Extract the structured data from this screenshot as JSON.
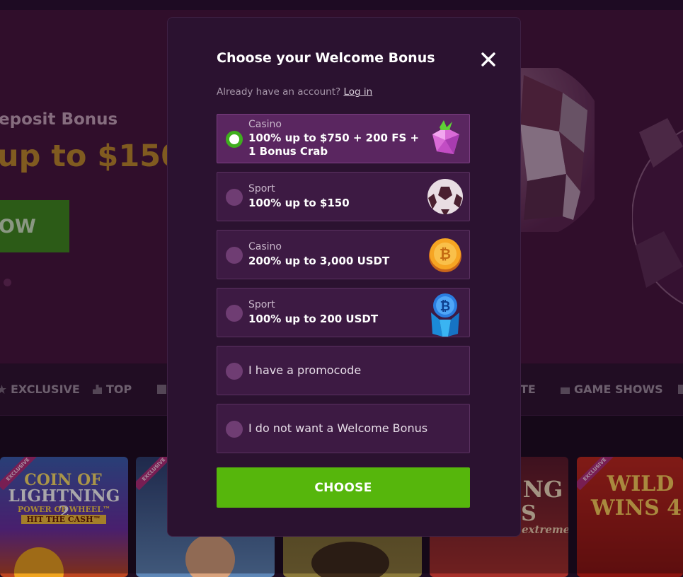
{
  "background": {
    "hero": {
      "subtitle": "eposit Bonus",
      "amount": "up to $150",
      "button_label": "OW"
    },
    "nav": [
      {
        "label": "EXCLUSIVE",
        "icon": "star-icon"
      },
      {
        "label": "TOP",
        "icon": "podium-icon"
      },
      {
        "label": "TE",
        "icon": ""
      },
      {
        "label": "GAME SHOWS",
        "icon": "game-shows-icon"
      }
    ],
    "tiles": [
      {
        "line1": "COIN OF",
        "line2": "LIGHTNING 2",
        "line3": "POWER OF WHEEL™",
        "line4": "HIT THE CASH™",
        "badge": "EXCLUSIVE"
      },
      {
        "badge": "EXCLUSIVE"
      },
      {},
      {
        "line1": "NG",
        "line2": "S",
        "line3": "extreme"
      },
      {
        "line1": "WILD",
        "line2": "WINS 4",
        "badge": "EXCLUSIVE"
      }
    ]
  },
  "modal": {
    "title": "Choose your Welcome Bonus",
    "login_prompt": "Already have an account?",
    "login_link": "Log in",
    "options": [
      {
        "category": "Casino",
        "lines": [
          "100% up to $750 + 200 FS +",
          "1 Bonus Crab"
        ],
        "icon": "gem-icon",
        "selected": true
      },
      {
        "category": "Sport",
        "lines": [
          "100% up to $150"
        ],
        "icon": "soccer-ball-icon",
        "selected": false
      },
      {
        "category": "Casino",
        "lines": [
          "200% up to 3,000 USDT"
        ],
        "icon": "bitcoin-coin-icon",
        "selected": false
      },
      {
        "category": "Sport",
        "lines": [
          "100% up to 200 USDT"
        ],
        "icon": "bitcoin-crystal-icon",
        "selected": false
      },
      {
        "label": "I have a promocode",
        "selected": false
      },
      {
        "label": "I do not want a Welcome Bonus",
        "selected": false
      }
    ],
    "choose_label": "CHOOSE"
  },
  "colors": {
    "modal_bg": "#2b1230",
    "option_bg": "#3d1a43",
    "selected_bg": "#5a2660",
    "accent_green": "#56b60c",
    "hero_gold": "#c08a2c"
  }
}
